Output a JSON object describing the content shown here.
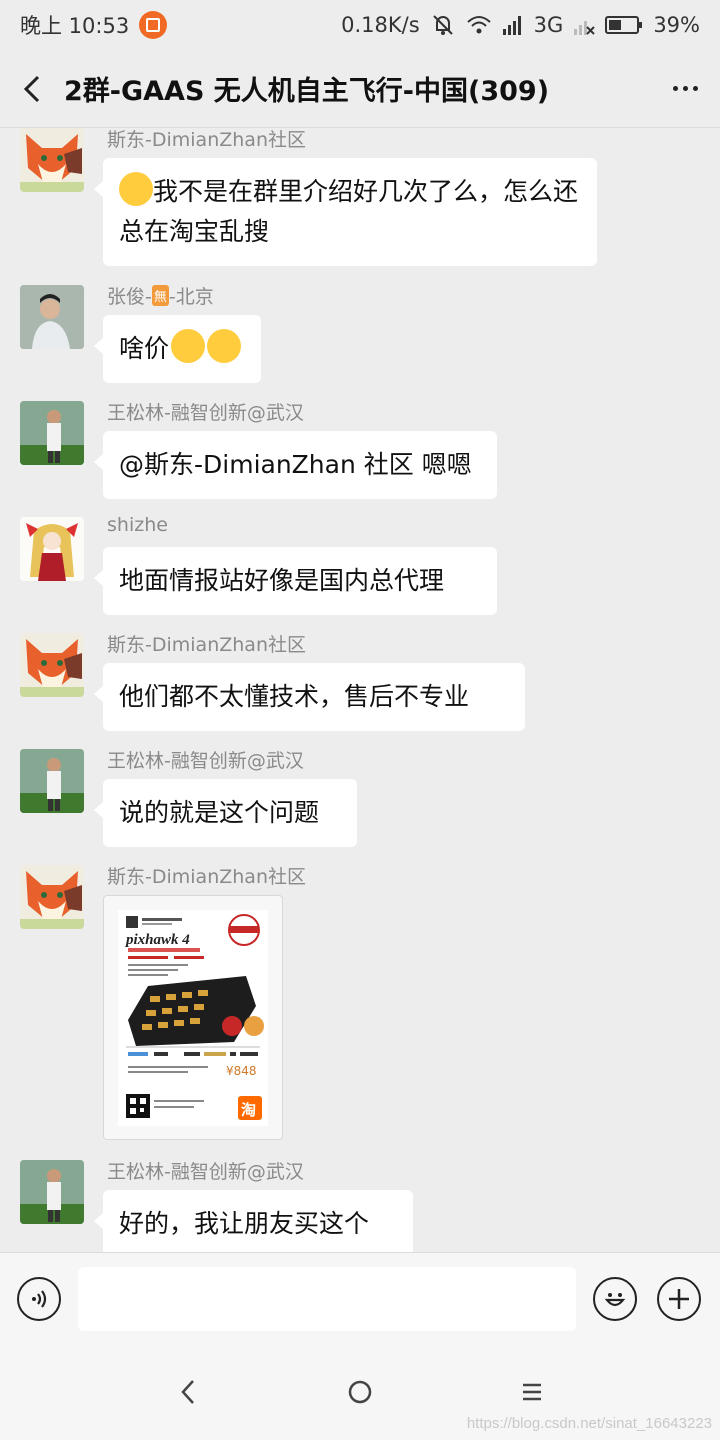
{
  "status_bar": {
    "time": "晚上 10:53",
    "network_speed": "0.18K/s",
    "network_type": "3G",
    "battery": "39%"
  },
  "header": {
    "title": "2群-GAAS 无人机自主飞行-中国(309)"
  },
  "messages": [
    {
      "sender": "斯东-DimianZhan社区",
      "text": "我不是在群里介绍好几次了么，怎么还总在淘宝乱搜",
      "avatar": "fox-avatar"
    },
    {
      "sender_prefix": "张俊-",
      "sender_badge": "無",
      "sender_suffix": "-北京",
      "text": "啥价",
      "avatar": "man-avatar"
    },
    {
      "sender": "王松林-融智创新@武汉",
      "text": "@斯东-DimianZhan 社区 嗯嗯",
      "avatar": "man-avatar"
    },
    {
      "sender": "shizhe",
      "text": "地面情报站好像是国内总代理",
      "avatar": "anime-avatar"
    },
    {
      "sender": "斯东-DimianZhan社区",
      "text": "他们都不太懂技术，售后不专业",
      "avatar": "fox-avatar"
    },
    {
      "sender": "王松林-融智创新@武汉",
      "text": "说的就是这个问题",
      "avatar": "man-avatar"
    },
    {
      "sender": "斯东-DimianZhan社区",
      "image": "pixhawk-product-poster",
      "avatar": "fox-avatar",
      "poster": {
        "brand": "pixhawk 4",
        "price": "¥848",
        "shop_badge": "淘"
      }
    },
    {
      "sender": "王松林-融智创新@武汉",
      "text": "好的，我让朋友买这个",
      "avatar": "man-avatar"
    }
  ],
  "input_bar": {
    "placeholder": ""
  },
  "watermark": "https://blog.csdn.net/sinat_16643223",
  "colors": {
    "background": "#ededed",
    "bubble": "#ffffff",
    "sender_text": "#8a8a8a",
    "accent_orange": "#f06a26"
  }
}
